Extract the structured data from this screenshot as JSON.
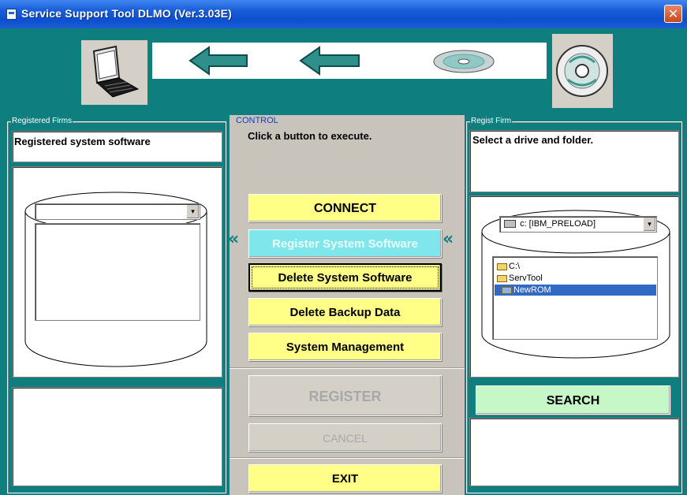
{
  "window": {
    "title": "Service Support Tool DLMO (Ver.3.03E)",
    "close_glyph": "✕"
  },
  "left": {
    "group_label": "Registered Firms",
    "caption": "Registered system software",
    "dropdown_arrow": "▾"
  },
  "center": {
    "group_label": "CONTROL",
    "instruction": "Click a button to execute.",
    "connect": "CONNECT",
    "register_system_software": "Register System Software",
    "delete_system_software": "Delete System Software",
    "delete_backup_data": "Delete Backup Data",
    "system_management": "System Management",
    "register": "REGISTER",
    "cancel": "CANCEL",
    "exit": "EXIT",
    "left_arrows": "«",
    "right_arrows": "«"
  },
  "right": {
    "group_label": "Regist Firm",
    "caption": "Select a drive and folder.",
    "drive": "c: [IBM_PRELOAD]",
    "dropdown_arrow": "▾",
    "folders": [
      "C:\\",
      "ServTool",
      "NewROM"
    ],
    "selected_folder": "NewROM",
    "search": "SEARCH"
  },
  "icons": [
    "laptop-icon",
    "left-arrow-icon",
    "cd-disc-icon"
  ],
  "colors": {
    "teal": "#0e7e7e",
    "yellow_button": "#ffff88",
    "cyan_button": "#7fe6ec",
    "green_button": "#c6f7c6",
    "selection": "#316ac5"
  }
}
